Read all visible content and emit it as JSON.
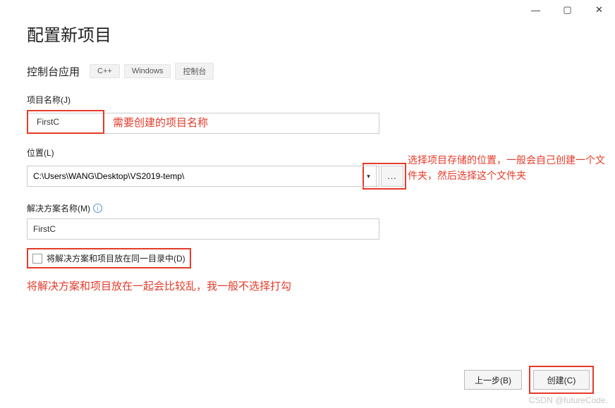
{
  "titlebar": {
    "min": "—",
    "max": "▢",
    "close": "✕"
  },
  "page": {
    "title": "配置新项目"
  },
  "subtitle": {
    "text": "控制台应用",
    "tags": [
      "C++",
      "Windows",
      "控制台"
    ]
  },
  "projectName": {
    "label": "项目名称(J)",
    "value": "FirstC"
  },
  "annotations": {
    "projectName": "需要创建的项目名称",
    "location": "选择项目存储的位置，一般会自己创建一个文件夹，然后选择这个文件夹",
    "checkbox": "将解决方案和项目放在一起会比较乱，我一般不选择打勾"
  },
  "location": {
    "label": "位置(L)",
    "value": "C:\\Users\\WANG\\Desktop\\VS2019-temp\\",
    "browse": "..."
  },
  "solution": {
    "label": "解决方案名称(M)",
    "value": "FirstC",
    "info": "i"
  },
  "checkbox": {
    "label": "将解决方案和项目放在同一目录中(D)"
  },
  "footer": {
    "back": "上一步(B)",
    "create": "创建(C)"
  },
  "watermark": "CSDN @futureCode."
}
